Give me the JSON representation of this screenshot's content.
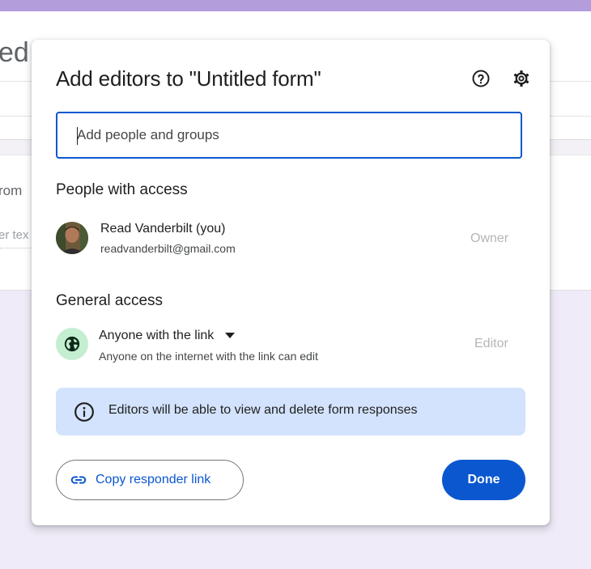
{
  "background": {
    "title_fragment": "ed",
    "form_fragment": "rom",
    "text_fragment": "er tex"
  },
  "dialog": {
    "title": "Add editors to \"Untitled form\"",
    "help_icon": "help-circle-icon",
    "settings_icon": "gear-icon",
    "add_people": {
      "placeholder": "Add people and groups",
      "value": ""
    },
    "people_section": {
      "heading": "People with access",
      "people": [
        {
          "name": "Read Vanderbilt (you)",
          "email": "readvanderbilt@gmail.com",
          "role": "Owner"
        }
      ]
    },
    "general_section": {
      "heading": "General access",
      "access_label": "Anyone with the link",
      "access_description": "Anyone on the internet with the link can edit",
      "role": "Editor",
      "icon": "globe-icon"
    },
    "info_banner": {
      "text": "Editors will be able to view and delete form responses",
      "icon": "info-icon"
    },
    "buttons": {
      "copy_link": "Copy responder link",
      "done": "Done"
    }
  },
  "colors": {
    "accent": "#0b57d0",
    "banner": "#d3e3fd",
    "globe_bg": "#c4eed0",
    "header_band": "#b39ddb",
    "page_bg": "#f0ebf8"
  }
}
